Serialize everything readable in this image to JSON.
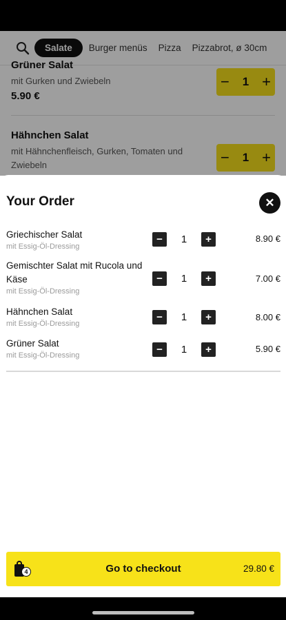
{
  "categories": {
    "items": [
      "Salate",
      "Burger menüs",
      "Pizza",
      "Pizzabrot, ø 30cm"
    ],
    "active": "Salate"
  },
  "menu": {
    "items": [
      {
        "name": "Grüner Salat",
        "desc": "mit Gurken und Zwiebeln",
        "price": "5.90 €",
        "qty": "1"
      },
      {
        "name": "Hähnchen Salat",
        "desc": "mit Hähnchenfleisch, Gurken, Tomaten und Zwiebeln",
        "qty": "1"
      }
    ]
  },
  "order": {
    "title": "Your Order",
    "items": [
      {
        "name": "Griechischer Salat",
        "note": "mit Essig-Öl-Dressing",
        "qty": "1",
        "price": "8.90 €"
      },
      {
        "name": "Gemischter Salat mit Rucola und Käse",
        "note": "mit Essig-Öl-Dressing",
        "qty": "1",
        "price": "7.00 €"
      },
      {
        "name": "Hähnchen Salat",
        "note": "mit Essig-Öl-Dressing",
        "qty": "1",
        "price": "8.00 €"
      },
      {
        "name": "Grüner Salat",
        "note": "mit Essig-Öl-Dressing",
        "qty": "1",
        "price": "5.90 €"
      }
    ]
  },
  "checkout": {
    "label": "Go to checkout",
    "total": "29.80 €",
    "count": "4"
  },
  "icons": {
    "search": "search-icon",
    "close": "close-icon",
    "bag": "shopping-bag-icon"
  },
  "colors": {
    "accent": "#f7e219",
    "dark": "#111111"
  }
}
